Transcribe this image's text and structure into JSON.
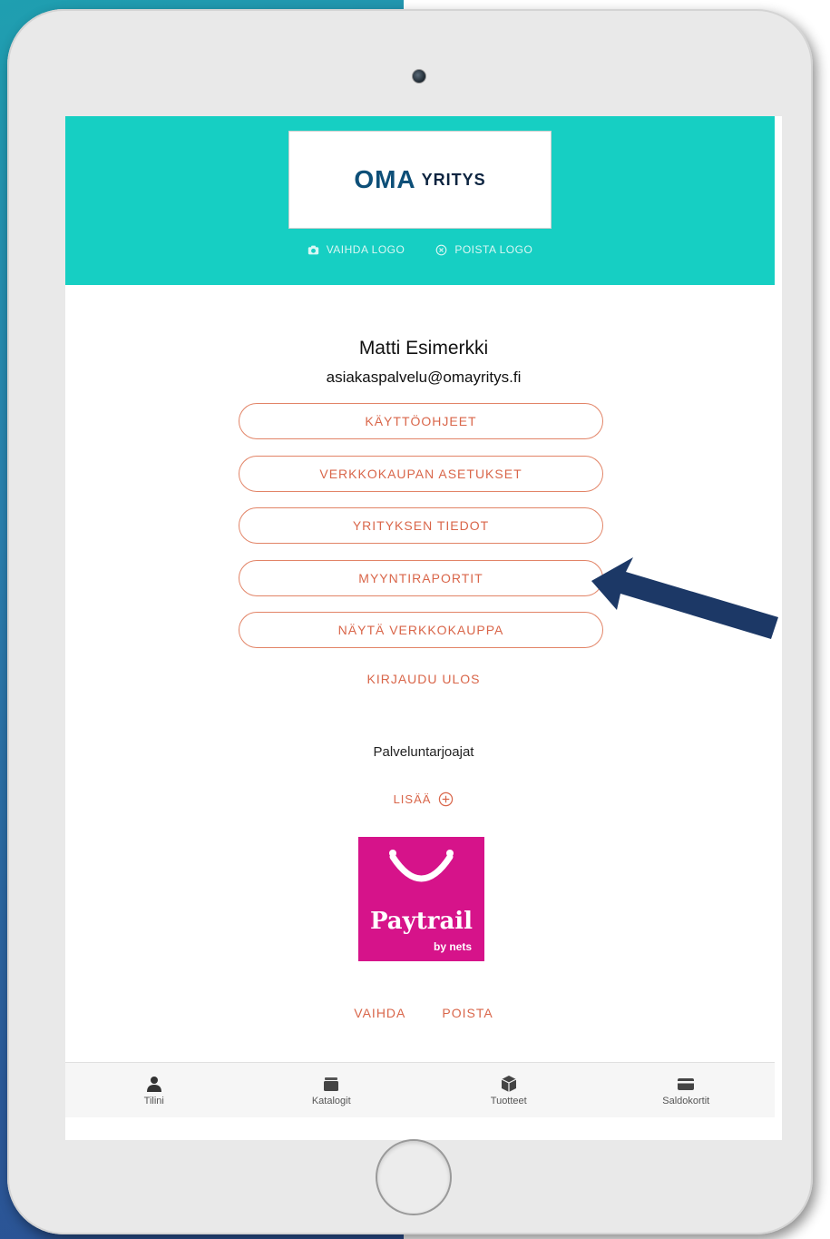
{
  "header": {
    "logo": {
      "part1": "OMA",
      "part2": "YRITYS"
    },
    "change_logo": "VAIHDA LOGO",
    "remove_logo": "POISTA LOGO"
  },
  "user": {
    "name": "Matti Esimerkki",
    "email": "asiakaspalvelu@omayritys.fi"
  },
  "menu": {
    "items": [
      "KÄYTTÖOHJEET",
      "VERKKOKAUPAN ASETUKSET",
      "YRITYKSEN TIEDOT",
      "MYYNTIRAPORTIT",
      "NÄYTÄ VERKKOKAUPPA"
    ],
    "logout": "KIRJAUDU ULOS"
  },
  "providers": {
    "title": "Palveluntarjoajat",
    "add_label": "LISÄÄ",
    "paytrail": {
      "name": "Paytrail",
      "sub": "by nets"
    },
    "change": "VAIHDA",
    "remove": "POISTA"
  },
  "tabbar": {
    "tabs": [
      {
        "label": "Tilini",
        "icon": "person-icon"
      },
      {
        "label": "Katalogit",
        "icon": "catalog-icon"
      },
      {
        "label": "Tuotteet",
        "icon": "box-icon"
      },
      {
        "label": "Saldokortit",
        "icon": "card-icon"
      }
    ]
  },
  "colors": {
    "header_bg": "#16cfc3",
    "accent": "#d9664a",
    "paytrail_bg": "#d6138a",
    "arrow": "#1c3866"
  }
}
